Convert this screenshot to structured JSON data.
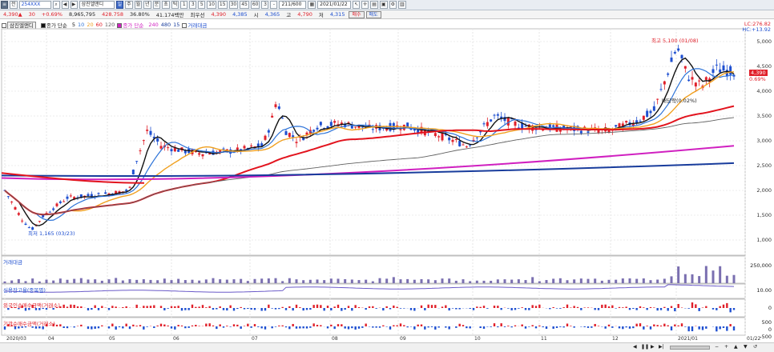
{
  "toolbar": {
    "period": "전",
    "stock_code": "254XXX",
    "stock_name": "삼진엘앤디",
    "tabs": [
      "주",
      "월",
      "년",
      "분",
      "초",
      "틱"
    ],
    "intervals": [
      "1",
      "3",
      "5",
      "10",
      "15",
      "30",
      "45",
      "60",
      "3"
    ],
    "count": "211/600",
    "date": "2021/01/22"
  },
  "quote": {
    "price": "4,390",
    "change": "30",
    "change_pct": "+0.69%",
    "volume": "8,965,795",
    "amount": "428.758",
    "ratio": "36.80%",
    "detail": "41.174백만",
    "mode": "최우선",
    "ask": "4,390",
    "bid": "4,385",
    "open_label": "시",
    "open": "4,365",
    "high_label": "고",
    "high": "4,790",
    "low_label": "저",
    "low": "4,315",
    "buy_label": "매수",
    "sell_label": "매도"
  },
  "legend": {
    "name": "삼진엘앤디",
    "ma_label": "종가 단순",
    "ma_periods": [
      "5",
      "10",
      "20",
      "60",
      "120"
    ],
    "ma_label2": "종가 단순",
    "ma_periods2": [
      "240",
      "480"
    ],
    "extra": "15",
    "volume_label": "거래대금"
  },
  "price_panel": {
    "right_top": "LC:276.82",
    "right_top2": "HC:+13.92",
    "current_price_tag": "4,390",
    "current_pct_tag": "0.69%",
    "high_note": "최고 5,100 (01/08)",
    "low_note": "최저 1,165 (03/23)",
    "dividend_note": "배당락(0.02%)",
    "y_ticks": [
      "5,000",
      "4,500",
      "4,000",
      "3,500",
      "3,000",
      "2,500",
      "2,000",
      "1,500",
      "1,000"
    ]
  },
  "panels": {
    "volume_title": "거래대금",
    "volume_tick": "250,000",
    "credit_title": "신용잔고율(종목별)",
    "credit_tick": "10.00",
    "foreign_title": "외국인순매수금액(거래소)",
    "foreign_tick": "0",
    "inst_title": "기관순매수금액(거래소)",
    "inst_ticks": [
      "500",
      "0",
      "-500"
    ]
  },
  "x_ticks": [
    "2020/03",
    "04",
    "05",
    "06",
    "07",
    "08",
    "09",
    "10",
    "11",
    "12",
    "2021/01",
    "01/22"
  ],
  "colors": {
    "up": "#e0202a",
    "down": "#1e4fd0",
    "ma5": "#111111",
    "ma10": "#2d73d8",
    "ma20": "#f0a020",
    "ma60": "#e2141e",
    "ma120": "#606060",
    "ma240": "#d020c0",
    "ma480": "#183c9c"
  }
}
